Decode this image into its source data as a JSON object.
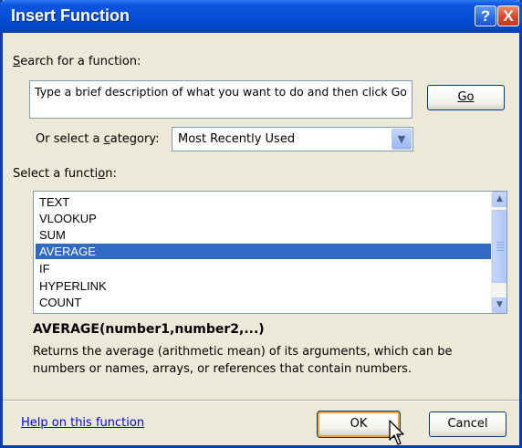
{
  "window": {
    "title": "Insert Function",
    "help_glyph": "?",
    "close_glyph": "X"
  },
  "search": {
    "label": "Search for a function:",
    "text": "Type a brief description of what you want to do and then click Go",
    "go_label": "Go"
  },
  "category": {
    "label": "Or select a category:",
    "selected": "Most Recently Used"
  },
  "functions": {
    "label": "Select a function:",
    "items": [
      "TEXT",
      "VLOOKUP",
      "SUM",
      "AVERAGE",
      "IF",
      "HYPERLINK",
      "COUNT"
    ],
    "selected": "AVERAGE"
  },
  "details": {
    "signature": "AVERAGE(number1,number2,...)",
    "description": "Returns the average (arithmetic mean) of its arguments, which can be numbers or names, arrays, or references that contain numbers."
  },
  "footer": {
    "help_link": "Help on this function",
    "ok_label": "OK",
    "cancel_label": "Cancel"
  },
  "colors": {
    "title_bar": "#0550D8",
    "selection": "#316AC5",
    "dialog_bg": "#ECE9D8",
    "link": "#0000FF"
  }
}
